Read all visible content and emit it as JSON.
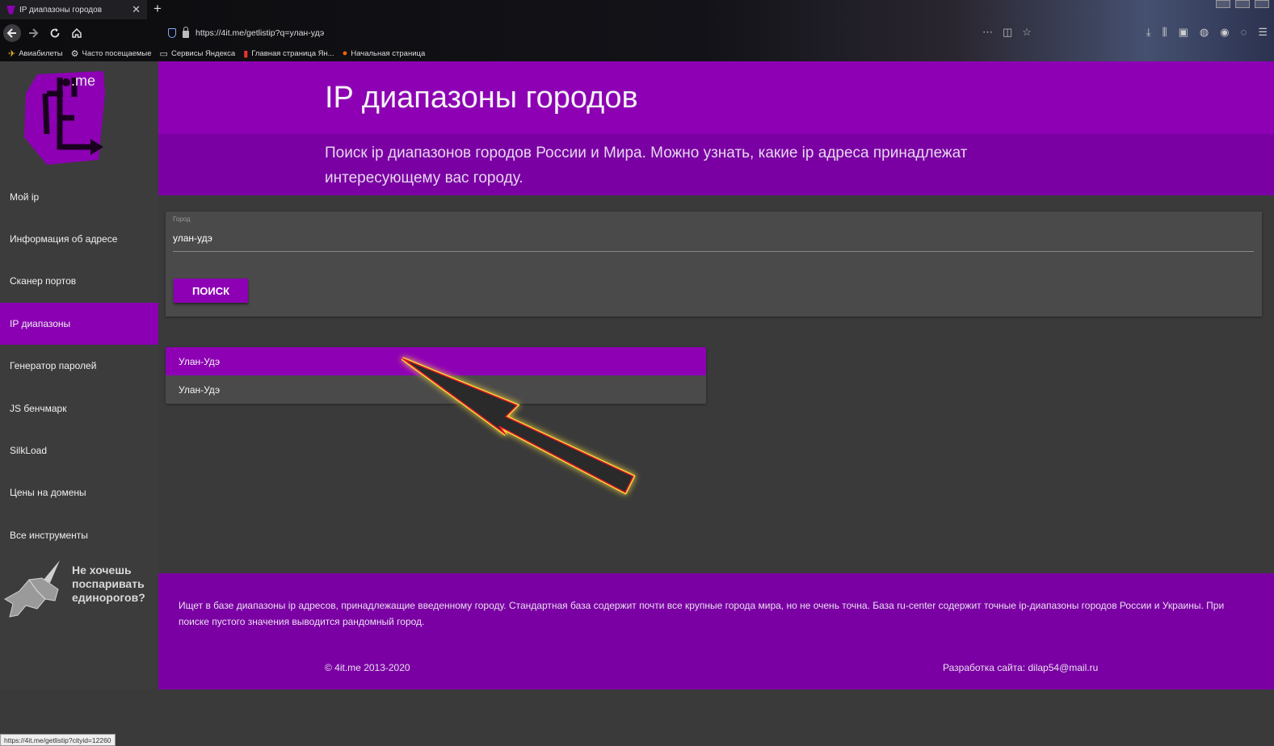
{
  "browser": {
    "tab_title": "IP диапазоны городов",
    "tab_close": "✕",
    "new_tab": "+",
    "url": "https://4it.me/getlistip?q=улан-удэ",
    "bookmarks": [
      {
        "icon": "plane-icon",
        "label": "Авиабилеты"
      },
      {
        "icon": "gear-icon",
        "label": "Часто посещаемые"
      },
      {
        "icon": "folder-icon",
        "label": "Сервисы Яндекса"
      },
      {
        "icon": "yandex-icon",
        "label": "Главная страница Ян..."
      },
      {
        "icon": "firefox-icon",
        "label": "Начальная страница"
      }
    ],
    "status_url": "https://4it.me/getlistip?cityid=12260"
  },
  "sidebar": {
    "logo_text": ".me",
    "items": [
      {
        "label": "Мой ip",
        "active": false
      },
      {
        "label": "Информация об адресе",
        "active": false
      },
      {
        "label": "Сканер портов",
        "active": false
      },
      {
        "label": "IP диапазоны",
        "active": true
      },
      {
        "label": "Генератор паролей",
        "active": false
      },
      {
        "label": "JS бенчмарк",
        "active": false
      },
      {
        "label": "SilkLoad",
        "active": false
      },
      {
        "label": "Цены на домены",
        "active": false
      },
      {
        "label": "Все инструменты",
        "active": false
      }
    ],
    "promo": "Не хочешь поспаривать единорогов?"
  },
  "header": {
    "title": "IP диапазоны городов",
    "subtitle": "Поиск ip диапазонов городов России и Мира. Можно узнать, какие ip адреса принадлежат интересующему вас городу."
  },
  "form": {
    "label": "Город",
    "value": "улан-удэ",
    "button": "ПОИСК"
  },
  "results": [
    "Улан-Удэ",
    "Улан-Удэ"
  ],
  "footer": {
    "description": "Ищет в базе диапазоны ip адресов, принадлежащие введенному городу. Стандартная база содержит почти все крупные города мира, но не очень точна. База ru-center содержит точные ip-диапазоны городов России и Украины. При поиске пустого значения выводится рандомный город.",
    "copyright": "© 4it.me 2013-2020",
    "developer": "Разработка сайта: dilap54@mail.ru"
  },
  "colors": {
    "accent": "#8d00b4",
    "accent_dark": "#7a00a3",
    "background": "#3a3a3a"
  }
}
